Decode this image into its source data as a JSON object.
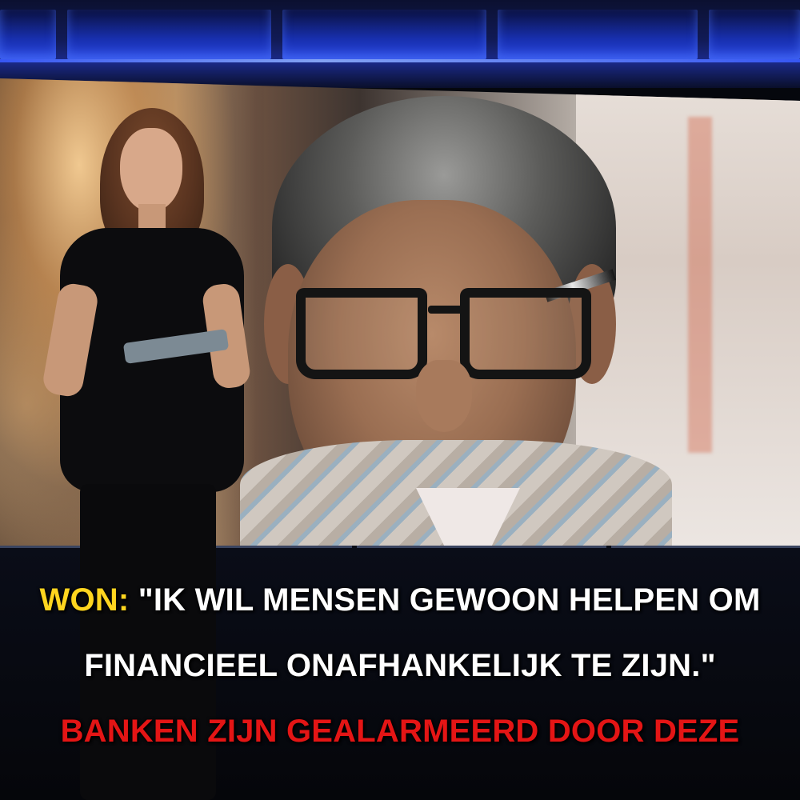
{
  "caption": {
    "speaker": "WON:",
    "line1_rest": "\"IK WIL MENSEN GEWOON HELPEN OM",
    "line2": "FINANCIEEL ONAFHANKELIJK TE ZIJN.\"",
    "line3": "BANKEN ZIJN GEALARMEERD DOOR DEZE"
  },
  "colors": {
    "speaker": "#ffd51f",
    "quote": "#ffffff",
    "headline": "#e41515"
  }
}
